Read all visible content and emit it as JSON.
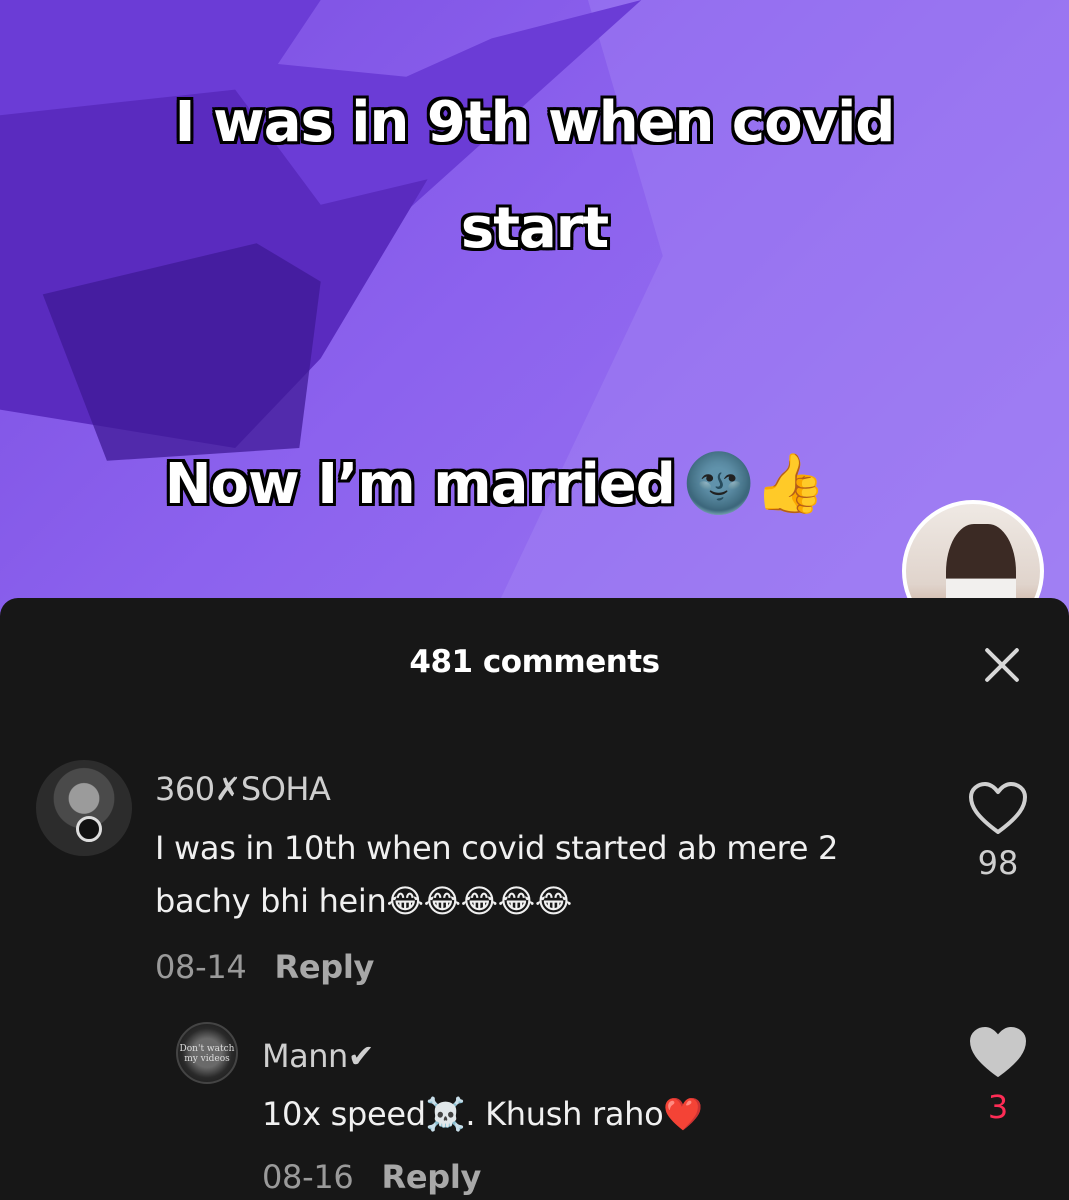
{
  "video": {
    "caption_line1": "I was in 9th when covid",
    "caption_line2": "start",
    "caption_line3": "Now I’m married",
    "caption_emoji": "🌚👍"
  },
  "comments_panel": {
    "title": "481 comments",
    "comments": [
      {
        "username": "360✗SOHA",
        "text": "I was in 10th when covid started ab mere 2 bachy bhi hein😂😂😂😂😂",
        "date": "08-14",
        "reply_label": "Reply",
        "likes": "98"
      },
      {
        "username": "Mann✔",
        "avatar_text": "Don't watch my videos",
        "text": "10x speed☠️. Khush raho❤️",
        "date": "08-16",
        "reply_label": "Reply",
        "likes": "3"
      }
    ]
  },
  "colors": {
    "sheet_bg": "#171717",
    "liked": "#fe2c55",
    "video_purple": "#8c62ee"
  }
}
